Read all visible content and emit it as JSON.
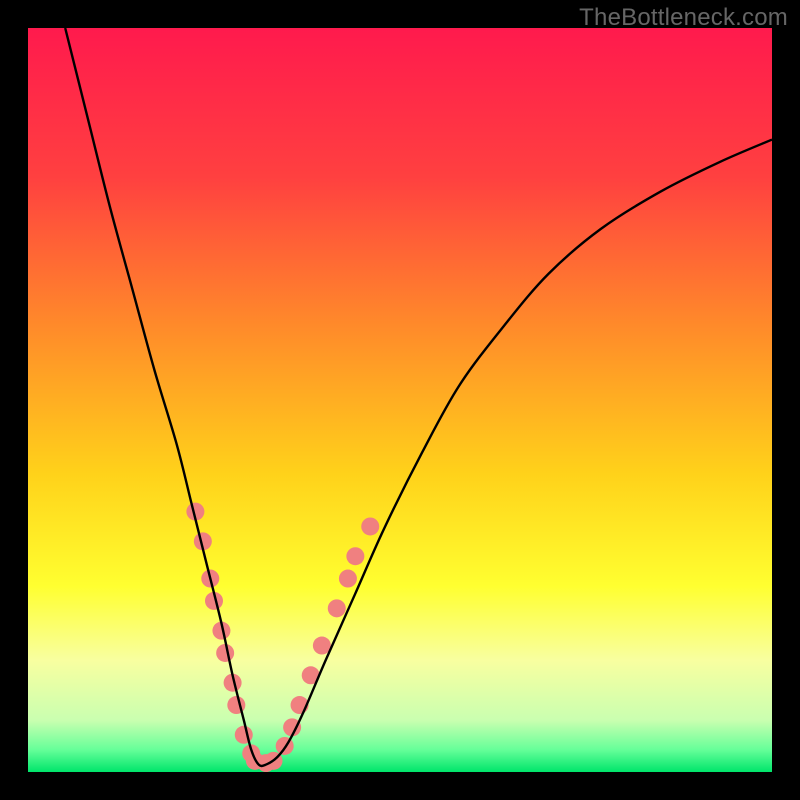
{
  "watermark": "TheBottleneck.com",
  "chart_data": {
    "type": "line",
    "title": "",
    "xlabel": "",
    "ylabel": "",
    "xlim": [
      0,
      100
    ],
    "ylim": [
      0,
      100
    ],
    "gradient_stops": [
      {
        "offset": 0.0,
        "color": "#ff1a4d"
      },
      {
        "offset": 0.2,
        "color": "#ff4040"
      },
      {
        "offset": 0.4,
        "color": "#ff8a2a"
      },
      {
        "offset": 0.6,
        "color": "#ffd21a"
      },
      {
        "offset": 0.75,
        "color": "#ffff30"
      },
      {
        "offset": 0.85,
        "color": "#f8ffa0"
      },
      {
        "offset": 0.93,
        "color": "#caffb0"
      },
      {
        "offset": 0.97,
        "color": "#66ff99"
      },
      {
        "offset": 1.0,
        "color": "#00e56b"
      }
    ],
    "series": [
      {
        "name": "bottleneck-curve",
        "color": "#000000",
        "x": [
          5,
          8,
          11,
          14,
          17,
          20,
          22,
          24,
          26,
          27.5,
          29,
          30,
          31,
          32,
          33.5,
          35,
          37,
          40,
          44,
          48,
          53,
          58,
          64,
          70,
          77,
          85,
          93,
          100
        ],
        "y": [
          100,
          88,
          76,
          65,
          54,
          44,
          36,
          28,
          20,
          13,
          7,
          3,
          1,
          1,
          2,
          4,
          8,
          15,
          24,
          33,
          43,
          52,
          60,
          67,
          73,
          78,
          82,
          85
        ]
      }
    ],
    "markers": {
      "name": "highlighted-points",
      "color": "#f08080",
      "radius": 9,
      "points": [
        {
          "x": 22.5,
          "y": 35
        },
        {
          "x": 23.5,
          "y": 31
        },
        {
          "x": 24.5,
          "y": 26
        },
        {
          "x": 25.0,
          "y": 23
        },
        {
          "x": 26.0,
          "y": 19
        },
        {
          "x": 26.5,
          "y": 16
        },
        {
          "x": 27.5,
          "y": 12
        },
        {
          "x": 28.0,
          "y": 9
        },
        {
          "x": 29.0,
          "y": 5
        },
        {
          "x": 30.0,
          "y": 2.5
        },
        {
          "x": 30.5,
          "y": 1.5
        },
        {
          "x": 32.0,
          "y": 1.2
        },
        {
          "x": 33.0,
          "y": 1.5
        },
        {
          "x": 34.5,
          "y": 3.5
        },
        {
          "x": 35.5,
          "y": 6
        },
        {
          "x": 36.5,
          "y": 9
        },
        {
          "x": 38.0,
          "y": 13
        },
        {
          "x": 39.5,
          "y": 17
        },
        {
          "x": 41.5,
          "y": 22
        },
        {
          "x": 43.0,
          "y": 26
        },
        {
          "x": 44.0,
          "y": 29
        },
        {
          "x": 46.0,
          "y": 33
        }
      ]
    }
  }
}
